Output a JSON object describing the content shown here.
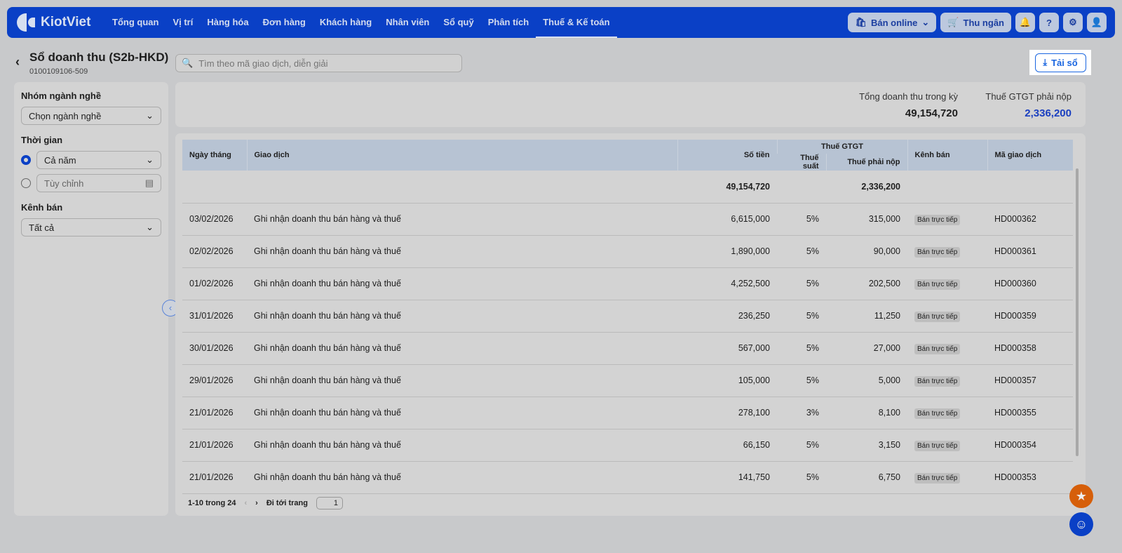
{
  "nav": {
    "brand": "KiotViet",
    "items": [
      "Tổng quan",
      "Vị trí",
      "Hàng hóa",
      "Đơn hàng",
      "Khách hàng",
      "Nhân viên",
      "Sổ quỹ",
      "Phân tích",
      "Thuế & Kế toán"
    ],
    "active": 8,
    "online": "Bán online",
    "cashier": "Thu ngân"
  },
  "page": {
    "title": "Sổ doanh thu (S2b-HKD)",
    "subtitle": "0100109106-509",
    "search_placeholder": "Tìm theo mã giao dịch, diễn giải",
    "download": "Tải sổ"
  },
  "filters": {
    "industry_label": "Nhóm ngành nghề",
    "industry_value": "Chọn ngành nghề",
    "time_label": "Thời gian",
    "time_year": "Cả năm",
    "time_custom": "Tùy chỉnh",
    "channel_label": "Kênh bán",
    "channel_value": "Tất cả"
  },
  "summary": {
    "revenue_label": "Tổng doanh thu trong kỳ",
    "revenue": "49,154,720",
    "vat_label": "Thuế GTGT phải nộp",
    "vat": "2,336,200"
  },
  "table": {
    "headers": {
      "date": "Ngày tháng",
      "desc": "Giao dịch",
      "amount": "Số tiền",
      "vat": "Thuế GTGT",
      "rate": "Thuế suất",
      "tax": "Thuế phải nộp",
      "channel": "Kênh bán",
      "code": "Mã giao dịch"
    },
    "total_amount": "49,154,720",
    "total_tax": "2,336,200",
    "rows": [
      [
        "03/02/2026",
        "Ghi nhận doanh thu bán hàng và thuế",
        "6,615,000",
        "5%",
        "315,000",
        "Bán trực tiếp",
        "HD000362"
      ],
      [
        "02/02/2026",
        "Ghi nhận doanh thu bán hàng và thuế",
        "1,890,000",
        "5%",
        "90,000",
        "Bán trực tiếp",
        "HD000361"
      ],
      [
        "01/02/2026",
        "Ghi nhận doanh thu bán hàng và thuế",
        "4,252,500",
        "5%",
        "202,500",
        "Bán trực tiếp",
        "HD000360"
      ],
      [
        "31/01/2026",
        "Ghi nhận doanh thu bán hàng và thuế",
        "236,250",
        "5%",
        "11,250",
        "Bán trực tiếp",
        "HD000359"
      ],
      [
        "30/01/2026",
        "Ghi nhận doanh thu bán hàng và thuế",
        "567,000",
        "5%",
        "27,000",
        "Bán trực tiếp",
        "HD000358"
      ],
      [
        "29/01/2026",
        "Ghi nhận doanh thu bán hàng và thuế",
        "105,000",
        "5%",
        "5,000",
        "Bán trực tiếp",
        "HD000357"
      ],
      [
        "21/01/2026",
        "Ghi nhận doanh thu bán hàng và thuế",
        "278,100",
        "3%",
        "8,100",
        "Bán trực tiếp",
        "HD000355"
      ],
      [
        "21/01/2026",
        "Ghi nhận doanh thu bán hàng và thuế",
        "66,150",
        "5%",
        "3,150",
        "Bán trực tiếp",
        "HD000354"
      ],
      [
        "21/01/2026",
        "Ghi nhận doanh thu bán hàng và thuế",
        "141,750",
        "5%",
        "6,750",
        "Bán trực tiếp",
        "HD000353"
      ]
    ]
  },
  "pager": {
    "range": "1-10 trong 24",
    "goto": "Đi tới trang",
    "page": "1"
  }
}
